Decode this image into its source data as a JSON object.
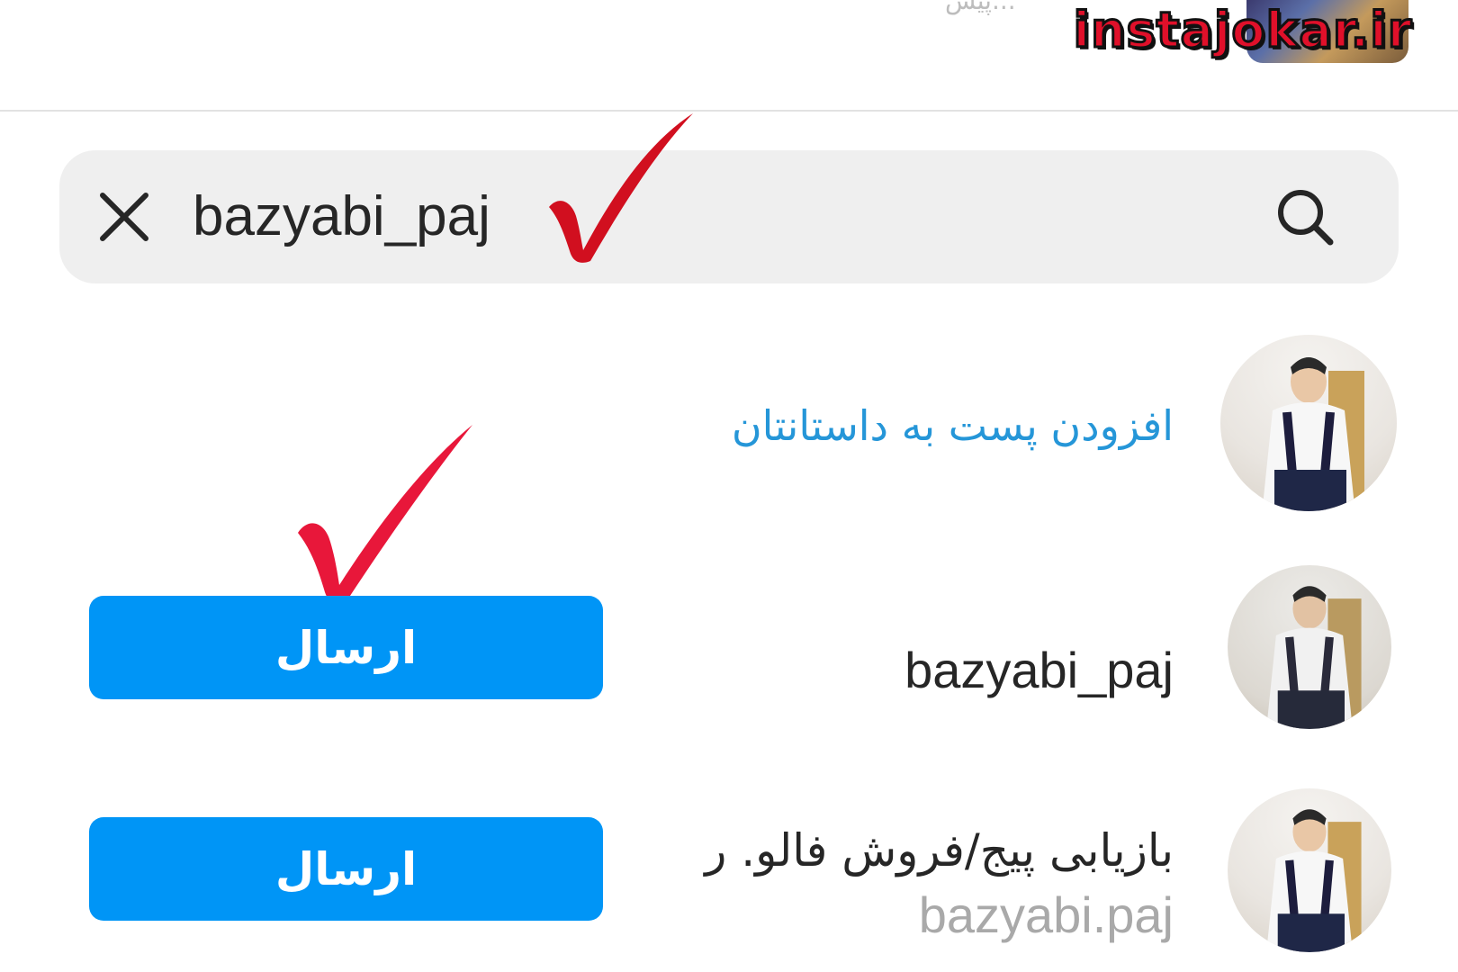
{
  "header": {
    "faded_text": "...پیش",
    "watermark": "instajokar.ir"
  },
  "search": {
    "value": "bazyabi_paj"
  },
  "rows": [
    {
      "label": "افزودن پست به داستانتان"
    },
    {
      "username": "bazyabi_paj",
      "button_label": "ارسال"
    },
    {
      "full_name": "بازیابی پیج/فروش فالو. ر",
      "username": "bazyabi.paj",
      "button_label": "ارسال"
    }
  ],
  "colors": {
    "accent": "#0095f6",
    "story_link": "#2596d8",
    "checkmark": "#e0102a",
    "search_bg": "#efefef"
  },
  "icons": [
    "close-icon",
    "search-icon",
    "checkmark-icon"
  ]
}
